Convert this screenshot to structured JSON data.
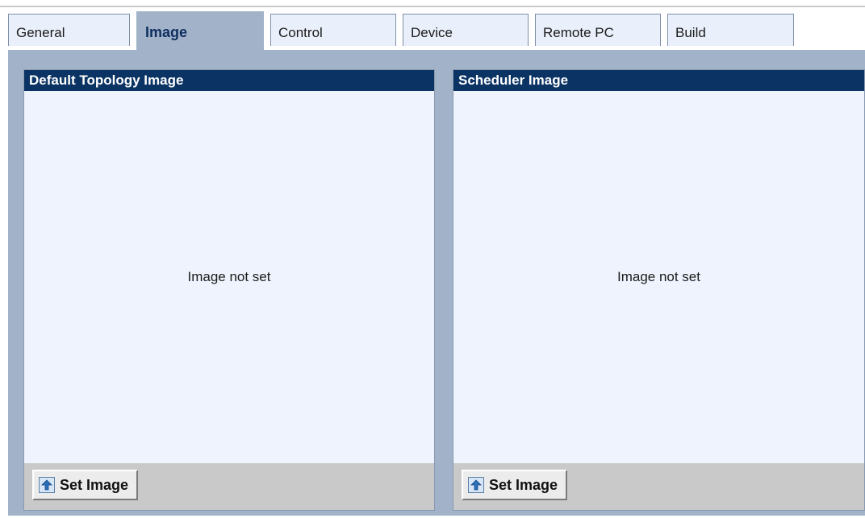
{
  "tabs": [
    {
      "label": "General"
    },
    {
      "label": "Image"
    },
    {
      "label": "Control"
    },
    {
      "label": "Device"
    },
    {
      "label": "Remote PC"
    },
    {
      "label": "Build"
    }
  ],
  "panels": {
    "topology": {
      "title": "Default Topology Image",
      "status": "Image not set",
      "button_label": "Set Image",
      "button_icon": "upload-arrow-icon"
    },
    "scheduler": {
      "title": "Scheduler Image",
      "status": "Image not set",
      "button_label": "Set Image",
      "button_icon": "upload-arrow-icon"
    }
  },
  "colors": {
    "accent": "#0b3464",
    "tab_active": "#a2b3c9",
    "panel_background": "#eef3fd",
    "footer": "#c9c9c9"
  }
}
